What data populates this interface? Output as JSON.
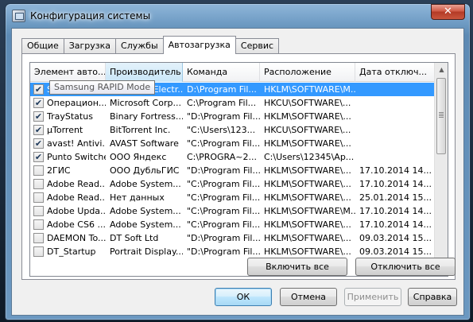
{
  "window": {
    "title": "Конфигурация системы",
    "close_glyph": "✕"
  },
  "tabs": [
    {
      "label": "Общие"
    },
    {
      "label": "Загрузка"
    },
    {
      "label": "Службы"
    },
    {
      "label": "Автозагрузка",
      "active": true
    },
    {
      "label": "Сервис"
    }
  ],
  "list": {
    "columns": [
      "Элемент авто...",
      "Производитель",
      "Команда",
      "Расположение",
      "Дата отключ..."
    ],
    "sorted_column": 1,
    "tooltip": "Samsung RAPID Mode",
    "rows": [
      {
        "checked": true,
        "name": "Samsung RAPID Mode",
        "maker": "Samsung Electr...",
        "command": "D:\\Program Fil...",
        "location": "HKLM\\SOFTWARE\\M...",
        "date": "",
        "selected": true
      },
      {
        "checked": true,
        "name": "Операцион...",
        "maker": "Microsoft Corp...",
        "command": "C:\\Program Fil...",
        "location": "HKCU\\SOFTWARE\\...",
        "date": ""
      },
      {
        "checked": true,
        "name": "TrayStatus",
        "maker": "Binary Fortress...",
        "command": "\"D:\\Program Fil...",
        "location": "HKLM\\SOFTWARE\\...",
        "date": ""
      },
      {
        "checked": true,
        "name": "µTorrent",
        "maker": "BitTorrent Inc.",
        "command": "\"C:\\Users\\123...",
        "location": "HKCU\\SOFTWARE\\...",
        "date": ""
      },
      {
        "checked": true,
        "name": "avast! Antivi...",
        "maker": "AVAST Software",
        "command": "\"C:\\Program Fil...",
        "location": "HKLM\\SOFTWARE\\...",
        "date": ""
      },
      {
        "checked": true,
        "name": "Punto Switcher",
        "maker": "ООО Яндекс",
        "command": "C:\\PROGRA~2...",
        "location": "C:\\Users\\12345\\Ap...",
        "date": ""
      },
      {
        "checked": false,
        "name": "2ГИС",
        "maker": "ООО ДубльГИС",
        "command": "\"D:\\Program Fil...",
        "location": "HKLM\\SOFTWARE\\...",
        "date": "17.10.2014 14..."
      },
      {
        "checked": false,
        "name": "Adobe Read...",
        "maker": "Adobe System...",
        "command": "\"C:\\Program Fil...",
        "location": "HKLM\\SOFTWARE\\...",
        "date": "17.10.2014 14..."
      },
      {
        "checked": false,
        "name": "Adobe Read...",
        "maker": "Нет данных",
        "command": "\"C:\\Program Fil...",
        "location": "HKLM\\SOFTWARE\\...",
        "date": "25.01.2014 15..."
      },
      {
        "checked": false,
        "name": "Adobe Upda...",
        "maker": "Adobe System...",
        "command": "\"C:\\Program Fil...",
        "location": "HKLM\\SOFTWARE\\M...",
        "date": "17.10.2014 14..."
      },
      {
        "checked": false,
        "name": "Adobe CS6 ...",
        "maker": "Adobe System...",
        "command": "\"C:\\Program Fil...",
        "location": "HKLM\\SOFTWARE\\...",
        "date": "17.10.2014 14..."
      },
      {
        "checked": false,
        "name": "DAEMON To...",
        "maker": "DT Soft Ltd",
        "command": "\"D:\\Program Fil...",
        "location": "HKLM\\SOFTWARE\\...",
        "date": "09.03.2014 15..."
      },
      {
        "checked": false,
        "name": "DT_Startup",
        "maker": "Portrait Display...",
        "command": "\"D:\\Program Fil...",
        "location": "HKLM\\SOFTWARE\\...",
        "date": "09.03.2014 15..."
      }
    ]
  },
  "buttons": {
    "enable_all": "Включить все",
    "disable_all": "Отключить все",
    "ok": "ОК",
    "cancel": "Отмена",
    "apply": "Применить",
    "help": "Справка"
  },
  "icons": {
    "check": "✔",
    "scroll_up": "▲",
    "scroll_down": "▼"
  }
}
